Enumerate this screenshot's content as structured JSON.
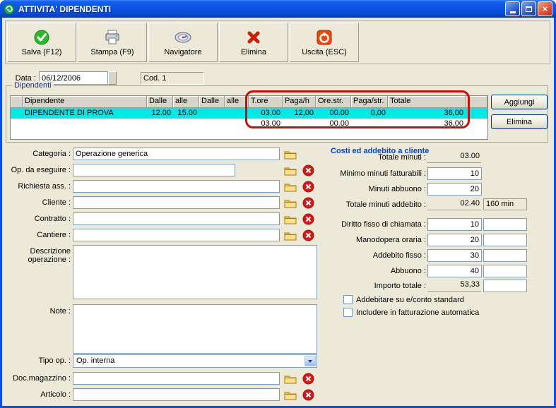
{
  "window": {
    "title": "ATTIVITA' DIPENDENTI"
  },
  "toolbar": {
    "buttons": [
      {
        "label": "Salva (F12)",
        "icon": "save-check-circle"
      },
      {
        "label": "Stampa (F9)",
        "icon": "printer"
      },
      {
        "label": "Navigatore",
        "icon": "compass-disc"
      },
      {
        "label": "Elimina",
        "icon": "red-x"
      },
      {
        "label": "Uscita (ESC)",
        "icon": "power-red"
      }
    ]
  },
  "header": {
    "data_label": "Data :",
    "data_value": "06/12/2006",
    "cod_value": "Cod. 1"
  },
  "dipendenti": {
    "group_label": "Dipendenti",
    "columns": [
      "Dipendente",
      "Dalle",
      "alle",
      "Dalle",
      "alle",
      "T.ore",
      "Paga/h",
      "Ore.str.",
      "Paga/str.",
      "Totale"
    ],
    "row1": {
      "dipendente": "DIPENDENTE DI PROVA",
      "dalle1": "12.00",
      "alle1": "15.00",
      "dalle2": "",
      "alle2": "",
      "t_ore": "03.00",
      "paga_h": "12,00",
      "ore_str": "00.00",
      "paga_str": "0,00",
      "totale": "36,00"
    },
    "row2": {
      "t_ore": "03.00",
      "ore_str": "00.00",
      "totale": "36,00"
    },
    "buttons": {
      "aggiungi": "Aggiungi",
      "elimina": "Elimina"
    }
  },
  "form": {
    "categoria": {
      "label": "Categoria :",
      "value": "Operazione generica"
    },
    "op_da_eseguire": {
      "label": "Op. da eseguire :",
      "value": ""
    },
    "richiesta_ass": {
      "label": "Richiesta ass. :",
      "value": ""
    },
    "cliente": {
      "label": "Cliente :",
      "value": ""
    },
    "contratto": {
      "label": "Contratto :",
      "value": ""
    },
    "cantiere": {
      "label": "Cantiere :",
      "value": ""
    },
    "descrizione": {
      "label": "Descrizione operazione :",
      "value": ""
    },
    "note": {
      "label": "Note :",
      "value": ""
    },
    "tipo_op": {
      "label": "Tipo op. :",
      "value": "Op. interna"
    },
    "doc_magazzino": {
      "label": "Doc.magazzino :",
      "value": ""
    },
    "articolo": {
      "label": "Articolo :",
      "value": ""
    }
  },
  "costi": {
    "title": "Costi ed addebito a cliente",
    "totale_minuti": {
      "label": "Totale minuti :",
      "value": "03.00"
    },
    "minimo_minuti": {
      "label": "Minimo minuti fatturabili :",
      "value": "10"
    },
    "minuti_abbuono": {
      "label": "Minuti abbuono :",
      "value": "20"
    },
    "totale_minuti_addebito": {
      "label": "Totale minuti addebito :",
      "value": "02.40",
      "extra": "160 min"
    },
    "diritto_fisso": {
      "label": "Diritto fisso di chiamata :",
      "value": "10",
      "extra": ""
    },
    "manodopera": {
      "label": "Manodopera oraria :",
      "value": "20",
      "extra": ""
    },
    "addebito_fisso": {
      "label": "Addebito fisso :",
      "value": "30",
      "extra": ""
    },
    "abbuono": {
      "label": "Abbuono :",
      "value": "40",
      "extra": ""
    },
    "importo_totale": {
      "label": "Importo totale :",
      "value": "53,33",
      "extra": ""
    },
    "check1": "Addebitare su e/conto standard",
    "check2": "Includere in fatturazione automatica"
  },
  "icons": {
    "folder": "yellow-folder",
    "clear": "red-circle-x",
    "dropdown": "chevron-down"
  },
  "colors": {
    "titlebar_blue": "#0b50e2",
    "window_bg": "#ECE9D8",
    "selected_row": "#00e9e9",
    "annotation_red": "#c90d0d",
    "section_title_blue": "#0046d5",
    "group_label_blue": "#16309c"
  }
}
